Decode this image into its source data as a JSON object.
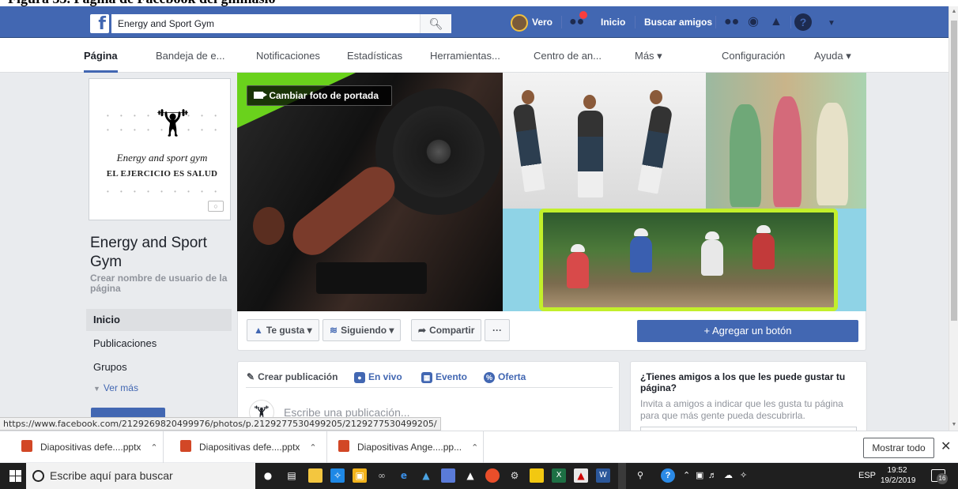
{
  "facebook": {
    "search_value": "Energy and Sport Gym",
    "user_name": "Vero",
    "nav_home": "Inicio",
    "nav_find_friends": "Buscar amigos"
  },
  "page_tabs": [
    "Página",
    "Bandeja de e...",
    "Notificaciones",
    "Estadísticas",
    "Herramientas...",
    "Centro de an...",
    "Más ▾",
    "Configuración",
    "Ayuda ▾"
  ],
  "profile": {
    "logo_script": "Energy and sport gym",
    "logo_slogan": "EL EJERCICIO ES SALUD",
    "page_name": "Energy and Sport Gym",
    "create_username": "Crear nombre de usuario de la página"
  },
  "left_nav": {
    "items": [
      "Inicio",
      "Publicaciones",
      "Grupos"
    ],
    "more": "Ver más"
  },
  "cover": {
    "change_cover_label": "Cambiar foto de portada"
  },
  "actions": {
    "like": "Te gusta",
    "following": "Siguiendo",
    "share": "Compartir",
    "more": "···",
    "add_button": "+ Agregar un botón"
  },
  "composer": {
    "create_post": "Crear publicación",
    "live": "En vivo",
    "event": "Evento",
    "offer": "Oferta",
    "placeholder": "Escribe una publicación..."
  },
  "invite": {
    "title": "¿Tienes amigos a los que les puede gustar tu página?",
    "text": "Invita a amigos a indicar que les gusta tu página para que más gente pueda descubrirla."
  },
  "status_url": "https://www.facebook.com/2129269820499976/photos/p.2129277530499205/2129277530499205/",
  "downloads": {
    "items": [
      "Diapositivas defe....pptx",
      "Diapositivas defe....pptx",
      "Diapositivas Ange....pp..."
    ],
    "show_all": "Mostrar todo"
  },
  "taskbar": {
    "search_placeholder": "Escribe aquí para buscar",
    "language": "ESP",
    "time": "19:52",
    "date": "19/2/2019",
    "notification_count": "16"
  },
  "colors": {
    "fb_blue": "#4267b2",
    "page_bg": "#e9ebee",
    "cover_accent_green": "#c2ef2b"
  }
}
